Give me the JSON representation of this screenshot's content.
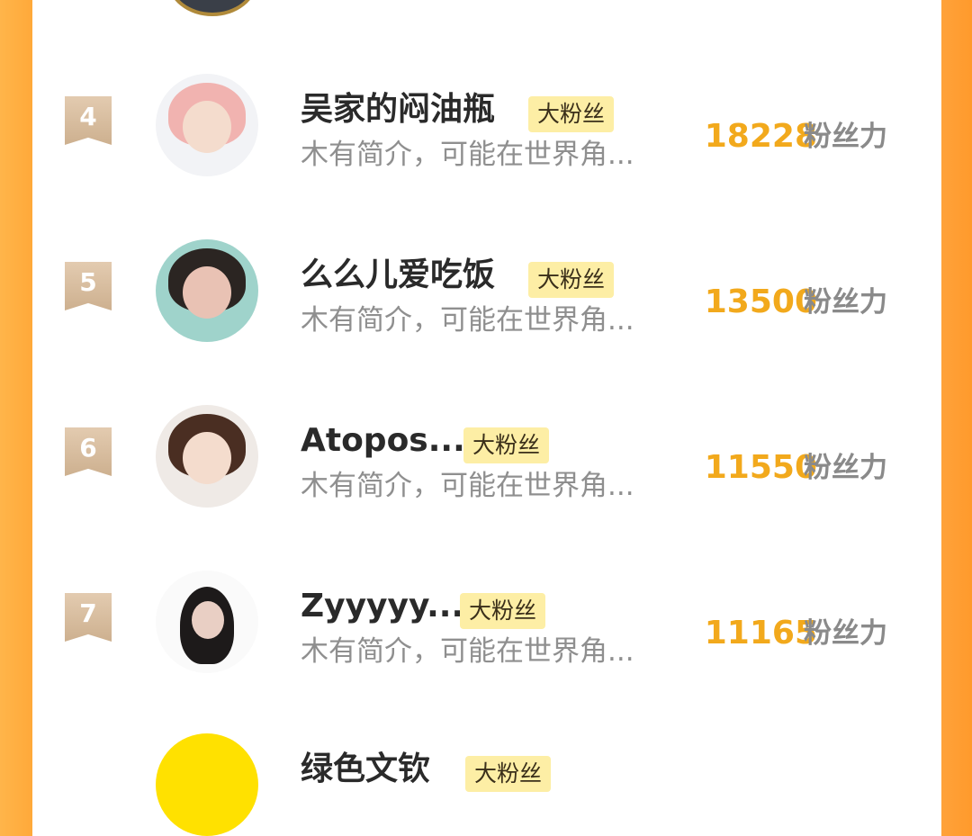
{
  "rows": [
    {
      "rank": "4",
      "name": "吴家的闷油瓶",
      "badge": "大粉丝",
      "bio": "木有简介，可能在世界角...",
      "score": "18228",
      "unit": "粉丝力"
    },
    {
      "rank": "5",
      "name": "么么儿爱吃饭",
      "badge": "大粉丝",
      "bio": "木有简介，可能在世界角...",
      "score": "13500",
      "unit": "粉丝力"
    },
    {
      "rank": "6",
      "name": "Atopos...",
      "badge": "大粉丝",
      "bio": "木有简介，可能在世界角...",
      "score": "11550",
      "unit": "粉丝力"
    },
    {
      "rank": "7",
      "name": "Zyyyyy...",
      "badge": "大粉丝",
      "bio": "木有简介，可能在世界角...",
      "score": "11165",
      "unit": "粉丝力"
    },
    {
      "name": "绿色文钦",
      "badge": "大粉丝"
    }
  ],
  "colors": {
    "accent": "#f2a91c",
    "badge_bg": "#fdeea5",
    "frame": "#ffa93a",
    "rank_bg": "#d6bb9c"
  }
}
